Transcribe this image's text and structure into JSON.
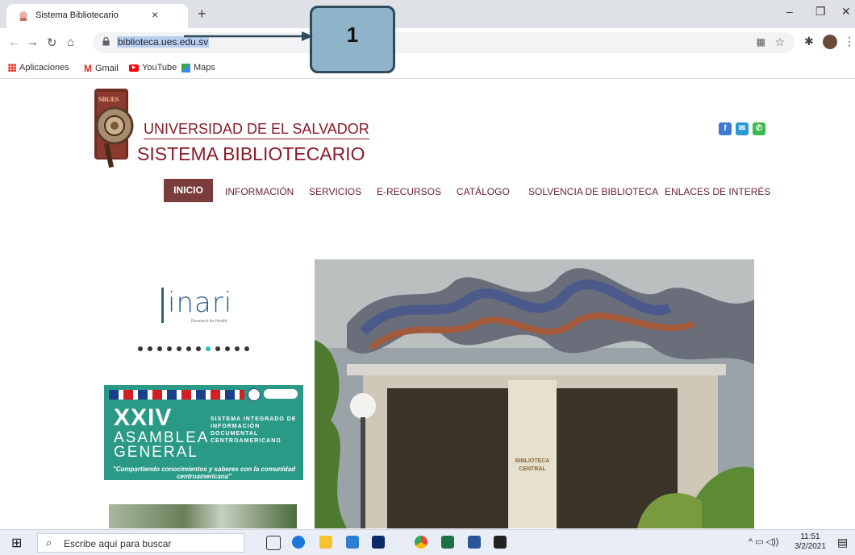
{
  "browser": {
    "tab_title": "Sistema Bibliotecario",
    "tab_close": "×",
    "new_tab": "+",
    "url": "biblioteca.ues.edu.sv",
    "bookmarks": [
      "Aplicaciones",
      "Gmail",
      "YouTube",
      "Maps"
    ]
  },
  "callout": {
    "label": "1"
  },
  "site": {
    "university": "UNIVERSIDAD DE EL SALVADOR",
    "system": "SISTEMA BIBLIOTECARIO",
    "social": {
      "facebook": "f",
      "email": "✉",
      "phone": "✆"
    },
    "nav": {
      "active": "INICIO",
      "items": [
        "INFORMACIÓN",
        "SERVICIOS",
        "E-RECURSOS",
        "CATÁLOGO",
        "SOLVENCIA DE BIBLIOTECA",
        "ENLACES DE INTERÉS"
      ]
    },
    "hinari": {
      "name": "inari",
      "tagline": "Research for Health"
    },
    "carousel": {
      "count": 12,
      "active_index": 7
    },
    "banner": {
      "roman": "XXIV",
      "line1": "ASAMBLEA",
      "line2": "GENERAL",
      "system": "SISTEMA INTEGRADO DE INFORMACIÓN DOCUMENTAL CENTROAMERICANO",
      "quote": "\"Compartiendo conocimientos y saberes con la comunidad centroamericana\""
    },
    "hero": {
      "sign_line1": "BIBLIOTECA",
      "sign_line2": "CENTRAL"
    }
  },
  "taskbar": {
    "search_placeholder": "Escribe aquí para buscar",
    "time": "11:51",
    "date": "3/2/2021"
  },
  "icons": {
    "back": "back-arrow-icon",
    "forward": "forward-arrow-icon",
    "reload": "reload-icon",
    "home": "home-icon",
    "lock": "lock-icon",
    "star": "star-icon",
    "extensions": "puzzle-icon"
  },
  "colors": {
    "brand": "#8a1a2a",
    "nav_active_bg": "#7a3c3c",
    "banner_bg": "#2a9a86",
    "carousel_active": "#2bbfc4"
  }
}
